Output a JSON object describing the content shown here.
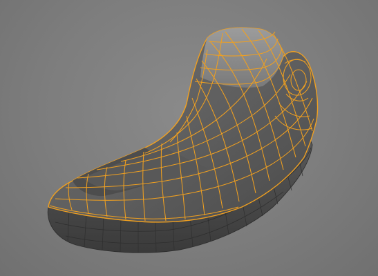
{
  "viewport": {
    "background": "#7d7d7d",
    "object": "foot-mesh",
    "selection_wire_color": "#f0a020",
    "unselected_wire_color": "#3a3a3a",
    "shading": "solid",
    "mode": "edit-mesh-wireframe-overlay"
  }
}
